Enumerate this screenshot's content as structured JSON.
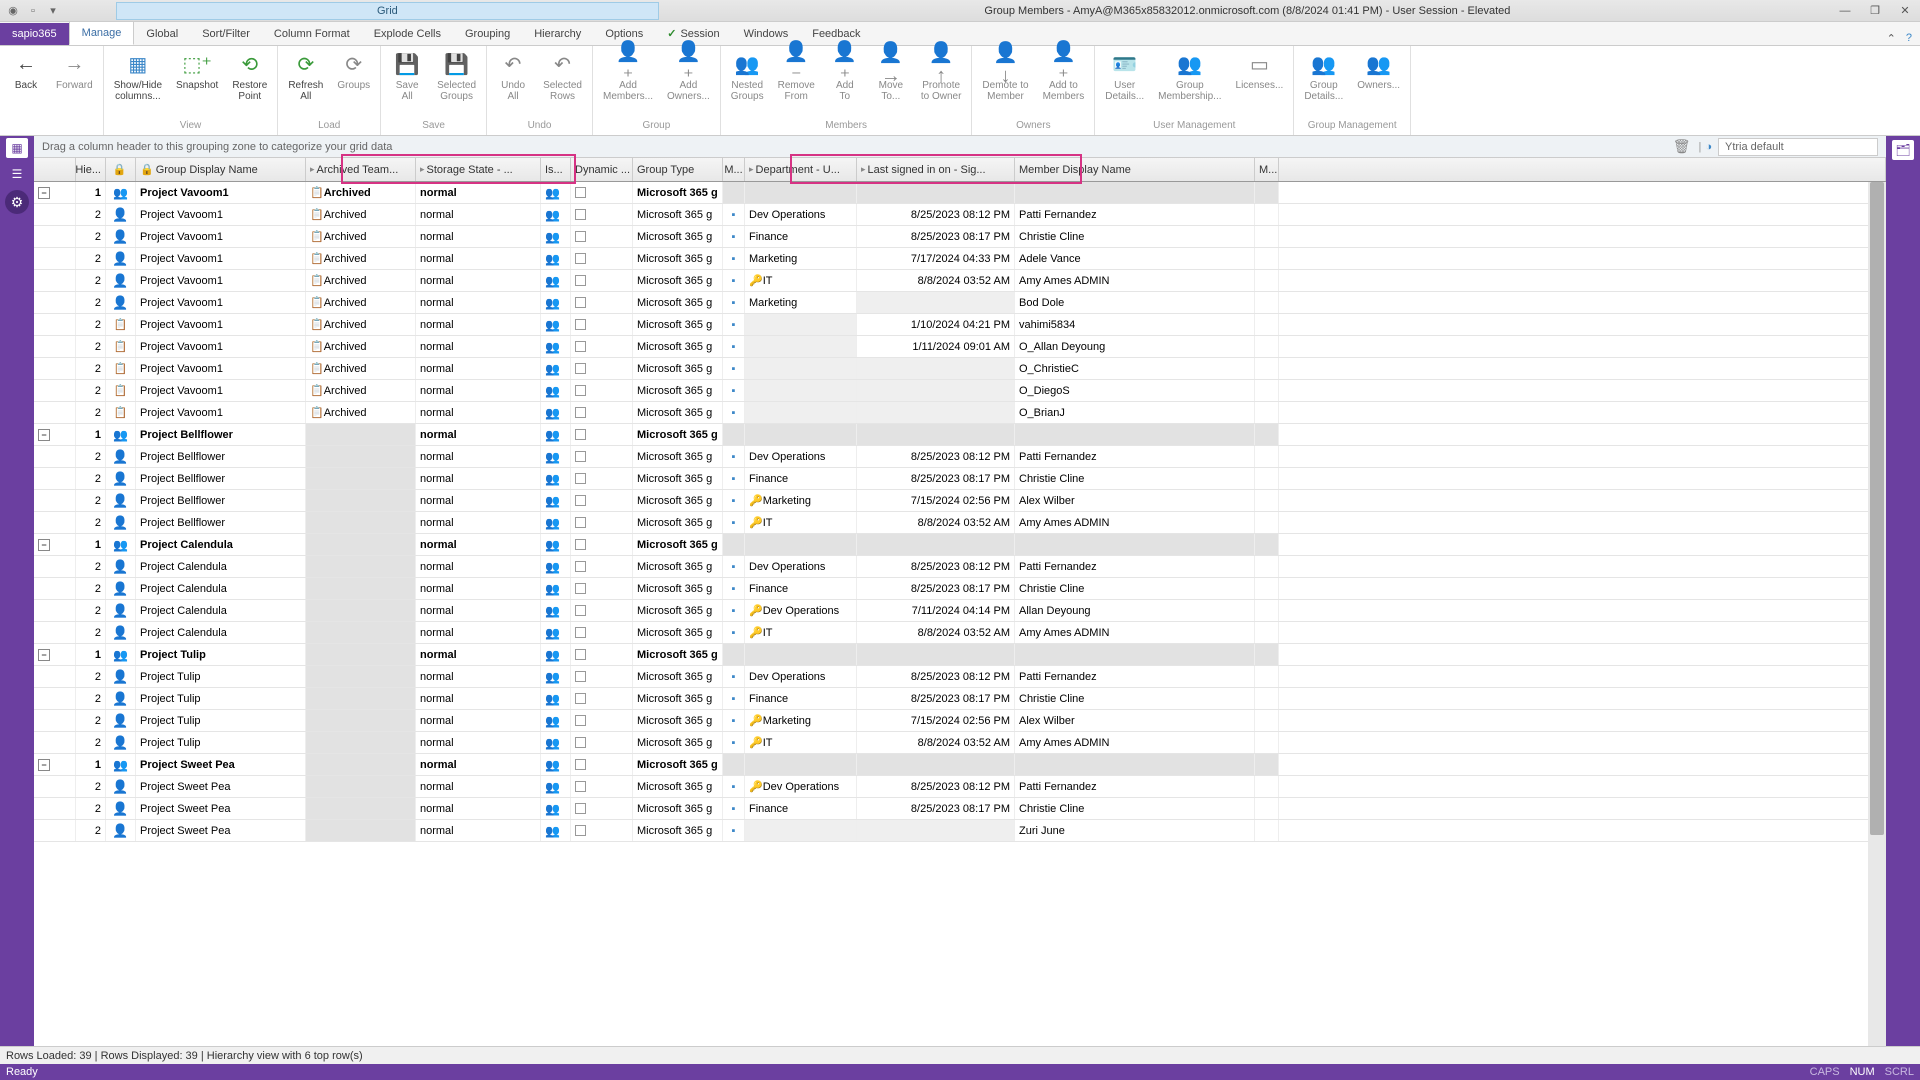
{
  "window": {
    "grid_tab": "Grid",
    "title": "Group Members - AmyA@M365x85832012.onmicrosoft.com (8/8/2024 01:41 PM) - User Session - Elevated"
  },
  "ribbon_tabs": {
    "app": "sapio365",
    "tabs": [
      "Manage",
      "Global",
      "Sort/Filter",
      "Column Format",
      "Explode Cells",
      "Grouping",
      "Hierarchy",
      "Options",
      "Session",
      "Windows",
      "Feedback"
    ],
    "active": "Manage"
  },
  "ribbon": {
    "nav": {
      "back": "Back",
      "forward": "Forward"
    },
    "view": {
      "showhide": "Show/Hide\ncolumns...",
      "snapshot": "Snapshot",
      "restore": "Restore\nPoint",
      "label": "View"
    },
    "load": {
      "refresh": "Refresh\nAll",
      "groups": "Groups",
      "label": "Load"
    },
    "save": {
      "all": "Save\nAll",
      "selected": "Selected\nGroups",
      "label": "Save"
    },
    "undo": {
      "all": "Undo\nAll",
      "rows": "Selected\nRows",
      "label": "Undo"
    },
    "group": {
      "addm": "Add\nMembers...",
      "addo": "Add\nOwners...",
      "label": "Group"
    },
    "members": {
      "nested": "Nested\nGroups",
      "remove": "Remove\nFrom",
      "add": "Add\nTo",
      "move": "Move\nTo...",
      "promote": "Promote\nto Owner",
      "label": "Members"
    },
    "owners": {
      "demote": "Demote to\nMember",
      "addm": "Add to\nMembers",
      "label": "Owners"
    },
    "um": {
      "user": "User\nDetails...",
      "gm": "Group\nMembership...",
      "lic": "Licenses...",
      "label": "User Management"
    },
    "gm": {
      "gd": "Group\nDetails...",
      "own": "Owners...",
      "label": "Group Management"
    }
  },
  "groupzone": {
    "text": "Drag a column header to this grouping zone to categorize your grid data",
    "preset": "Ytria default"
  },
  "columns": {
    "hie": "Hie...",
    "gdn": "Group Display Name",
    "arch": "Archived Team...",
    "stor": "Storage State - ...",
    "is": "Is...",
    "dyn": "Dynamic ...",
    "gt": "Group Type",
    "m": "M...",
    "dept": "Department - U...",
    "last": "Last signed in on - Sig...",
    "member": "Member Display Name",
    "m2": "M..."
  },
  "groups": [
    {
      "name": "Project Vavoom1",
      "archived": "Archived",
      "storage": "normal",
      "gt": "Microsoft 365 g",
      "rows": [
        {
          "dept": "Dev Operations",
          "last": "8/25/2023 08:12 PM",
          "member": "Patti Fernandez",
          "archived": "Archived",
          "pico": "p"
        },
        {
          "dept": "Finance",
          "last": "8/25/2023 08:17 PM",
          "member": "Christie Cline",
          "archived": "Archived",
          "pico": "p"
        },
        {
          "dept": "Marketing",
          "last": "7/17/2024 04:33 PM",
          "member": "Adele Vance",
          "archived": "Archived",
          "pico": "p"
        },
        {
          "dept": "IT",
          "last": "8/8/2024 03:52 AM",
          "member": "Amy Ames ADMIN",
          "archived": "Archived",
          "pico": "p",
          "sec": true
        },
        {
          "dept": "Marketing",
          "last": "",
          "member": "Bod Dole",
          "archived": "Archived",
          "pico": "p",
          "shade": true
        },
        {
          "dept": "",
          "last": "1/10/2024 04:21 PM",
          "member": "vahimi5834",
          "archived": "Archived",
          "pico": "c",
          "deptshade": true
        },
        {
          "dept": "",
          "last": "1/11/2024 09:01 AM",
          "member": "O_Allan Deyoung",
          "archived": "Archived",
          "pico": "c",
          "deptshade": true
        },
        {
          "dept": "",
          "last": "",
          "member": "O_ChristieC",
          "archived": "Archived",
          "pico": "c",
          "deptshade": true,
          "shade": true
        },
        {
          "dept": "",
          "last": "",
          "member": "O_DiegoS",
          "archived": "Archived",
          "pico": "c",
          "deptshade": true,
          "shade": true
        },
        {
          "dept": "",
          "last": "",
          "member": "O_BrianJ",
          "archived": "Archived",
          "pico": "c",
          "deptshade": true,
          "shade": true
        }
      ]
    },
    {
      "name": "Project Bellflower",
      "archived": "",
      "storage": "normal",
      "gt": "Microsoft 365 g",
      "rows": [
        {
          "dept": "Dev Operations",
          "last": "8/25/2023 08:12 PM",
          "member": "Patti Fernandez",
          "pico": "p"
        },
        {
          "dept": "Finance",
          "last": "8/25/2023 08:17 PM",
          "member": "Christie Cline",
          "pico": "p"
        },
        {
          "dept": "Marketing",
          "last": "7/15/2024 02:56 PM",
          "member": "Alex Wilber",
          "pico": "p",
          "sec": true
        },
        {
          "dept": "IT",
          "last": "8/8/2024 03:52 AM",
          "member": "Amy Ames ADMIN",
          "pico": "p",
          "sec": true
        }
      ]
    },
    {
      "name": "Project Calendula",
      "archived": "",
      "storage": "normal",
      "gt": "Microsoft 365 g",
      "rows": [
        {
          "dept": "Dev Operations",
          "last": "8/25/2023 08:12 PM",
          "member": "Patti Fernandez",
          "pico": "p"
        },
        {
          "dept": "Finance",
          "last": "8/25/2023 08:17 PM",
          "member": "Christie Cline",
          "pico": "p"
        },
        {
          "dept": "Dev Operations",
          "last": "7/11/2024 04:14 PM",
          "member": "Allan Deyoung",
          "pico": "p",
          "sec": true
        },
        {
          "dept": "IT",
          "last": "8/8/2024 03:52 AM",
          "member": "Amy Ames ADMIN",
          "pico": "p",
          "sec": true
        }
      ]
    },
    {
      "name": "Project Tulip",
      "archived": "",
      "storage": "normal",
      "gt": "Microsoft 365 g",
      "rows": [
        {
          "dept": "Dev Operations",
          "last": "8/25/2023 08:12 PM",
          "member": "Patti Fernandez",
          "pico": "p"
        },
        {
          "dept": "Finance",
          "last": "8/25/2023 08:17 PM",
          "member": "Christie Cline",
          "pico": "p"
        },
        {
          "dept": "Marketing",
          "last": "7/15/2024 02:56 PM",
          "member": "Alex Wilber",
          "pico": "p",
          "sec": true
        },
        {
          "dept": "IT",
          "last": "8/8/2024 03:52 AM",
          "member": "Amy Ames ADMIN",
          "pico": "p",
          "sec": true
        }
      ]
    },
    {
      "name": "Project Sweet Pea",
      "archived": "",
      "storage": "normal",
      "gt": "Microsoft 365 g",
      "rows": [
        {
          "dept": "Dev Operations",
          "last": "8/25/2023 08:12 PM",
          "member": "Patti Fernandez",
          "pico": "p",
          "sec": true
        },
        {
          "dept": "Finance",
          "last": "8/25/2023 08:17 PM",
          "member": "Christie Cline",
          "pico": "p"
        },
        {
          "dept": "",
          "last": "",
          "member": "Zuri June",
          "pico": "p",
          "shade": true,
          "deptshade": true
        }
      ]
    }
  ],
  "status": {
    "line1": "Rows Loaded: 39 | Rows Displayed: 39 | Hierarchy view with 6 top row(s)",
    "ready": "Ready",
    "caps": "CAPS",
    "num": "NUM",
    "scrl": "SCRL"
  }
}
